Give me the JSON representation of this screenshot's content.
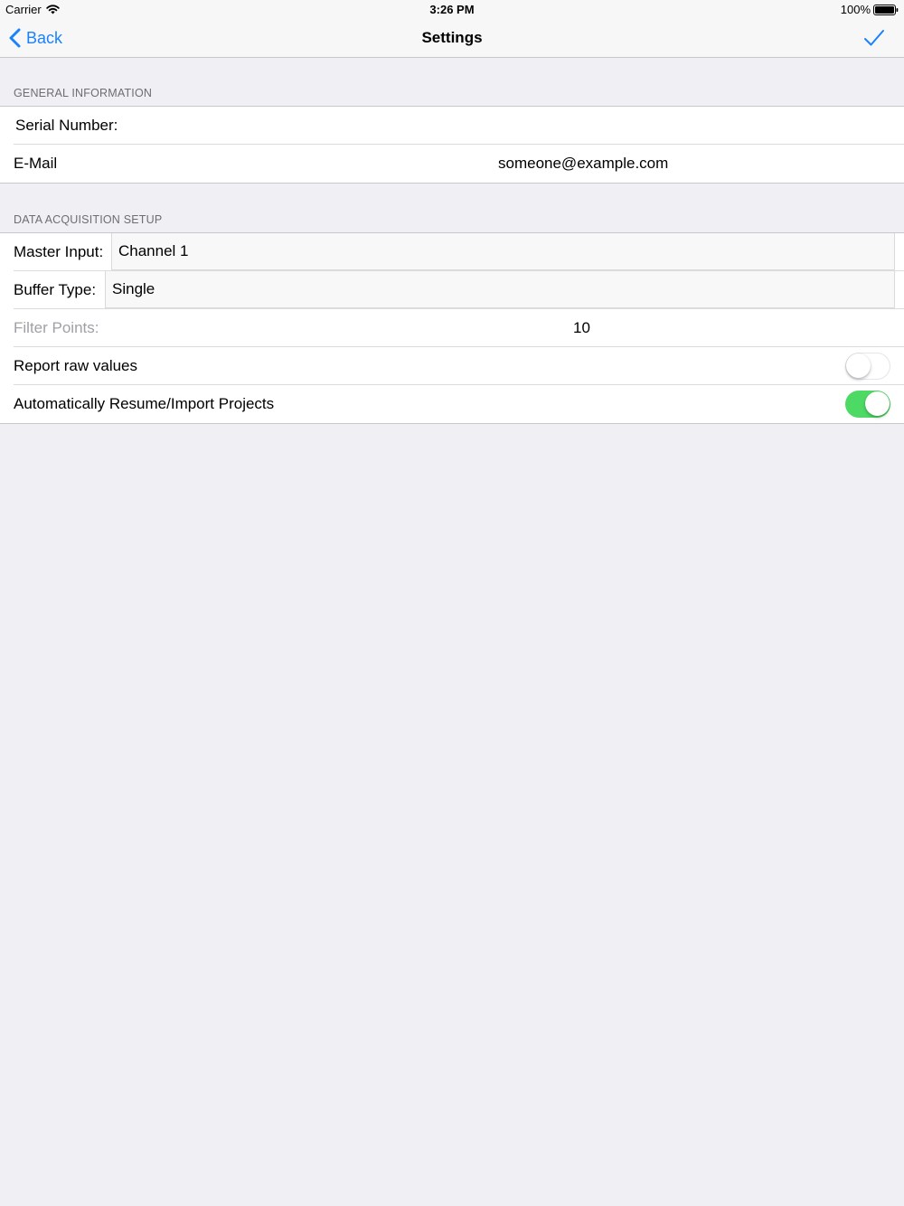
{
  "status_bar": {
    "carrier": "Carrier",
    "time": "3:26 PM",
    "battery_percent": "100%"
  },
  "nav": {
    "back_label": "Back",
    "title": "Settings",
    "done_icon": "checkmark-icon"
  },
  "general_information": {
    "header": "GENERAL INFORMATION",
    "serial_label": "Serial Number:",
    "serial_value": "",
    "email_label": "E-Mail",
    "email_value": "someone@example.com"
  },
  "data_acquisition": {
    "header": "DATA ACQUISITION SETUP",
    "master_input_label": "Master Input:",
    "master_input_value": "Channel 1",
    "buffer_type_label": "Buffer Type:",
    "buffer_type_value": "Single",
    "filter_points_label": "Filter Points:",
    "filter_points_value": "10",
    "report_raw_label": "Report raw values",
    "report_raw_on": false,
    "auto_resume_label": "Automatically Resume/Import Projects",
    "auto_resume_on": true
  },
  "colors": {
    "accent": "#1a82fb",
    "toggle_on": "#4cd964",
    "background": "#efeff4"
  }
}
